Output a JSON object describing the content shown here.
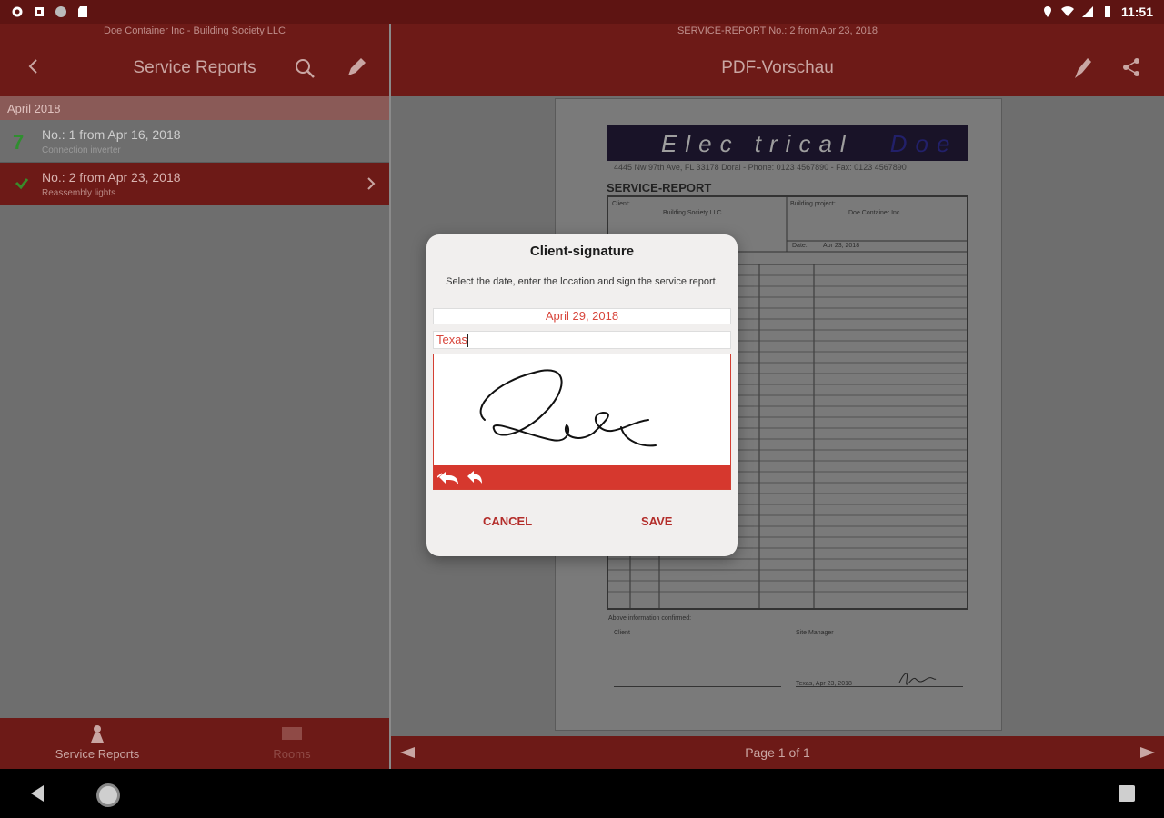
{
  "status_bar": {
    "time": "11:51"
  },
  "left_pane": {
    "subtitle": "Doe Container Inc - Building Society LLC",
    "title": "Service Reports",
    "section": "April 2018",
    "items": [
      {
        "icon_text": "7",
        "title": "No.: 1 from Apr 16, 2018",
        "subtitle": "Connection inverter"
      },
      {
        "icon_text": "",
        "title": "No.: 2 from Apr 23, 2018",
        "subtitle": "Reassembly lights"
      }
    ],
    "bottom_nav": [
      {
        "label": "Service Reports",
        "icon": "worker-icon"
      },
      {
        "label": "Rooms",
        "icon": "room-icon"
      }
    ]
  },
  "right_pane": {
    "subtitle": "SERVICE-REPORT No.: 2 from Apr 23, 2018",
    "title": "PDF-Vorschau",
    "page_indicator": "Page 1 of 1",
    "pdf": {
      "logo_text": "Elec trical",
      "logo_doe": "Doe",
      "address": "4445 Nw 97th Ave, FL 33178 Doral - Phone: 0123 4567890 - Fax: 0123 4567890",
      "heading": "SERVICE-REPORT",
      "client_label": "Client:",
      "project_label": "Building project:",
      "client_name": "Building Society LLC",
      "project_name": "Doe Container Inc",
      "date_label": "Date:",
      "date_value": "Apr 23, 2018",
      "confirm_label": "Above information confirmed:",
      "client_sig_label": "Client",
      "manager_label": "Site Manager",
      "manager_sig_text": "Texas, Apr 23, 2018"
    }
  },
  "dialog": {
    "title": "Client-signature",
    "description": "Select the date, enter the location and sign the service report.",
    "date": "April 29, 2018",
    "location": "Texas",
    "cancel_label": "CANCEL",
    "save_label": "SAVE"
  },
  "colors": {
    "primary_dark": "#6d1a17",
    "accent": "#d6382e",
    "dialog_bg": "#f1efee",
    "scrim": "#6e6e6e"
  }
}
